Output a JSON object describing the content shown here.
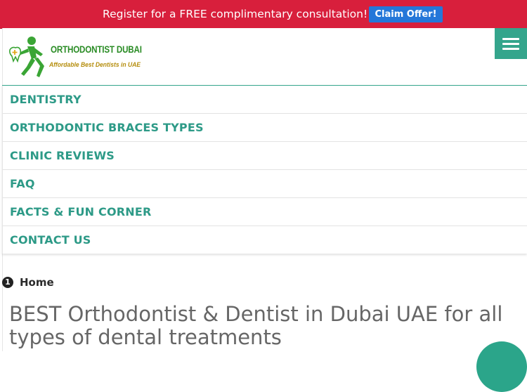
{
  "promo_bar": {
    "text": "Register for a FREE complimentary consultation!",
    "button_label": "Claim Offer!"
  },
  "logo": {
    "name": "ORTHODONTIST DUBAI",
    "tagline": "Affordable Best Dentists in UAE"
  },
  "nav": {
    "items": [
      {
        "label": "DENTISTRY"
      },
      {
        "label": "ORTHODONTIC BRACES TYPES"
      },
      {
        "label": "CLINIC REVIEWS"
      },
      {
        "label": "FAQ"
      },
      {
        "label": "FACTS & FUN CORNER"
      },
      {
        "label": "CONTACT US"
      }
    ]
  },
  "breadcrumb": {
    "icon_text": "1",
    "home_label": "Home"
  },
  "page": {
    "title": "BEST Orthodontist & Dentist in Dubai UAE for all types of dental treatments"
  },
  "colors": {
    "promo_bg": "#d81f3c",
    "claim_button": "#2477d9",
    "accent_teal": "#34a58c",
    "nav_text": "#2d9a87",
    "logo_green": "#2a8c25",
    "tagline_gold": "#b58d0c"
  },
  "icons": {
    "menu": "hamburger-menu-icon",
    "logo": "running-dentist-figure-icon",
    "breadcrumb": "numbered-circle-icon"
  }
}
